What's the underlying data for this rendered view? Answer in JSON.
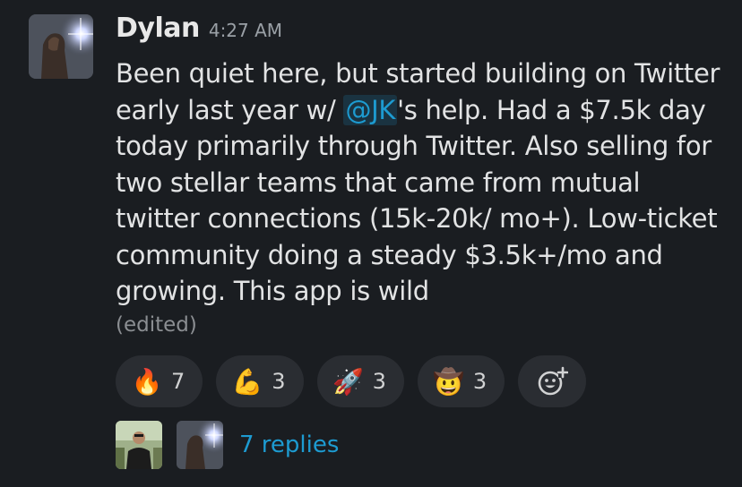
{
  "message": {
    "sender": "Dylan",
    "time": "4:27 AM",
    "text_before": "Been quiet here, but started building on Twitter early last year w/ ",
    "mention": "@JK",
    "text_after": "'s help. Had a $7.5k day today primarily through Twitter. Also selling for two stellar teams that came from mutual twitter connections (15k-20k/ mo+). Low-ticket community doing a steady $3.5k+/mo and growing. This app is wild",
    "edited": "(edited)"
  },
  "reactions": [
    {
      "emoji": "🔥",
      "icon": "fire-icon",
      "count": "7"
    },
    {
      "emoji": "💪",
      "icon": "flexed-biceps-icon",
      "count": "3"
    },
    {
      "emoji": "🚀",
      "icon": "rocket-icon",
      "count": "3"
    },
    {
      "emoji": "🤠",
      "icon": "cowboy-face-icon",
      "count": "3"
    }
  ],
  "add_reaction_icon": "add-reaction-icon",
  "thread": {
    "replies": "7 replies"
  },
  "colors": {
    "background": "#1a1d21",
    "link": "#1d9bd1",
    "pill": "#2a2d32"
  }
}
